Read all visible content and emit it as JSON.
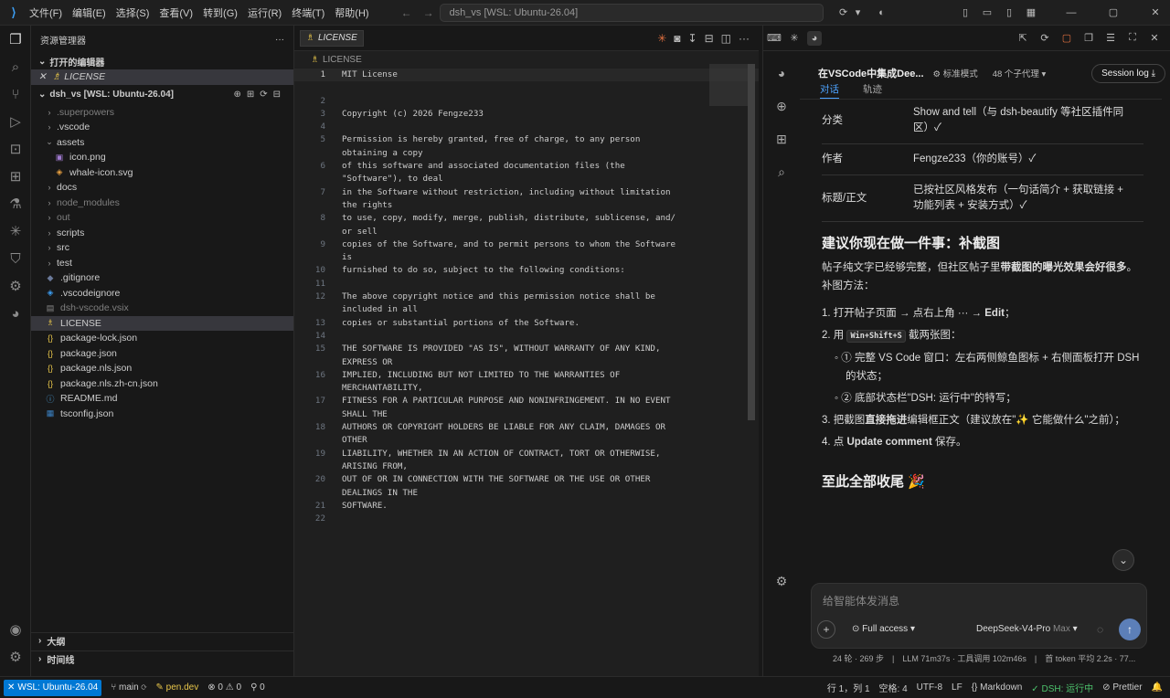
{
  "titlebar": {
    "menu": [
      "文件(F)",
      "编辑(E)",
      "选择(S)",
      "查看(V)",
      "转到(G)",
      "运行(R)",
      "终端(T)",
      "帮助(H)"
    ],
    "command_center": "dsh_vs [WSL: Ubuntu-26.04]"
  },
  "sidebar": {
    "title": "资源管理器",
    "open_editors": "打开的编辑器",
    "open_file": "LICENSE",
    "workspace": "dsh_vs [WSL: Ubuntu-26.04]",
    "tree": [
      {
        "name": ".superpowers",
        "type": "folder",
        "dim": true,
        "depth": 1
      },
      {
        "name": ".vscode",
        "type": "folder",
        "depth": 1
      },
      {
        "name": "assets",
        "type": "open",
        "depth": 1
      },
      {
        "name": "icon.png",
        "type": "img",
        "depth": 2
      },
      {
        "name": "whale-icon.svg",
        "type": "svg",
        "depth": 2
      },
      {
        "name": "docs",
        "type": "folder",
        "depth": 1
      },
      {
        "name": "node_modules",
        "type": "folder",
        "dim": true,
        "depth": 1
      },
      {
        "name": "out",
        "type": "folder",
        "dim": true,
        "depth": 1
      },
      {
        "name": "scripts",
        "type": "folder",
        "depth": 1
      },
      {
        "name": "src",
        "type": "folder",
        "depth": 1
      },
      {
        "name": "test",
        "type": "folder",
        "depth": 1
      },
      {
        "name": ".gitignore",
        "type": "git",
        "depth": 1
      },
      {
        "name": ".vscodeignore",
        "type": "vs",
        "depth": 1
      },
      {
        "name": "dsh-vscode.vsix",
        "type": "pkg",
        "dim": true,
        "depth": 1
      },
      {
        "name": "LICENSE",
        "type": "lic",
        "depth": 1,
        "sel": true
      },
      {
        "name": "package-lock.json",
        "type": "json",
        "depth": 1
      },
      {
        "name": "package.json",
        "type": "json",
        "depth": 1
      },
      {
        "name": "package.nls.json",
        "type": "json",
        "depth": 1
      },
      {
        "name": "package.nls.zh-cn.json",
        "type": "json",
        "depth": 1
      },
      {
        "name": "README.md",
        "type": "md",
        "depth": 1
      },
      {
        "name": "tsconfig.json",
        "type": "ts",
        "depth": 1
      }
    ],
    "outline": "大纲",
    "timeline": "时间线"
  },
  "editor": {
    "tab": "LICENSE",
    "breadcrumb": "LICENSE",
    "lines": [
      {
        "n": "1",
        "t": "MIT License"
      },
      {
        "n": "",
        "t": ""
      },
      {
        "n": "2",
        "t": ""
      },
      {
        "n": "3",
        "t": "Copyright (c) 2026 Fengze233"
      },
      {
        "n": "4",
        "t": ""
      },
      {
        "n": "5",
        "t": "Permission is hereby granted, free of charge, to any person"
      },
      {
        "n": "",
        "t": "obtaining a copy"
      },
      {
        "n": "6",
        "t": "of this software and associated documentation files (the"
      },
      {
        "n": "",
        "t": "\"Software\"), to deal"
      },
      {
        "n": "7",
        "t": "in the Software without restriction, including without limitation"
      },
      {
        "n": "",
        "t": "the rights"
      },
      {
        "n": "8",
        "t": "to use, copy, modify, merge, publish, distribute, sublicense, and/"
      },
      {
        "n": "",
        "t": "or sell"
      },
      {
        "n": "9",
        "t": "copies of the Software, and to permit persons to whom the Software"
      },
      {
        "n": "",
        "t": "is"
      },
      {
        "n": "10",
        "t": "furnished to do so, subject to the following conditions:"
      },
      {
        "n": "11",
        "t": ""
      },
      {
        "n": "12",
        "t": "The above copyright notice and this permission notice shall be"
      },
      {
        "n": "",
        "t": "included in all"
      },
      {
        "n": "13",
        "t": "copies or substantial portions of the Software."
      },
      {
        "n": "14",
        "t": ""
      },
      {
        "n": "15",
        "t": "THE SOFTWARE IS PROVIDED \"AS IS\", WITHOUT WARRANTY OF ANY KIND,"
      },
      {
        "n": "",
        "t": "EXPRESS OR"
      },
      {
        "n": "16",
        "t": "IMPLIED, INCLUDING BUT NOT LIMITED TO THE WARRANTIES OF"
      },
      {
        "n": "",
        "t": "MERCHANTABILITY,"
      },
      {
        "n": "17",
        "t": "FITNESS FOR A PARTICULAR PURPOSE AND NONINFRINGEMENT. IN NO EVENT"
      },
      {
        "n": "",
        "t": "SHALL THE"
      },
      {
        "n": "18",
        "t": "AUTHORS OR COPYRIGHT HOLDERS BE LIABLE FOR ANY CLAIM, DAMAGES OR"
      },
      {
        "n": "",
        "t": "OTHER"
      },
      {
        "n": "19",
        "t": "LIABILITY, WHETHER IN AN ACTION OF CONTRACT, TORT OR OTHERWISE,"
      },
      {
        "n": "",
        "t": "ARISING FROM,"
      },
      {
        "n": "20",
        "t": "OUT OF OR IN CONNECTION WITH THE SOFTWARE OR THE USE OR OTHER"
      },
      {
        "n": "",
        "t": "DEALINGS IN THE"
      },
      {
        "n": "21",
        "t": "SOFTWARE."
      },
      {
        "n": "22",
        "t": ""
      }
    ]
  },
  "chat": {
    "title": "在VSCode中集成Dee...",
    "mode": "标准模式",
    "agents": "48 个子代理",
    "session_log": "Session log",
    "tab_chat": "对话",
    "tab_track": "轨迹",
    "table": [
      [
        "分类",
        "Show and tell（与 dsh-beautify 等社区插件同区）✓"
      ],
      [
        "作者",
        "Fengze233（你的账号）✓"
      ],
      [
        "标题/正文",
        "已按社区风格发布（一句话简介 + 获取链接 + 功能列表 + 安装方式）✓"
      ]
    ],
    "h1": "建议你现在做一件事：补截图",
    "p1a": "帖子纯文字已经够完整，但社区帖子里",
    "p1b": "带截图的曝光效果会好很多",
    "p1c": "。补图方法：",
    "s1a": "1. 打开帖子页面 → 点右上角 ··· → ",
    "s1b": "Edit",
    "s1c": "；",
    "s2a": "2. 用 ",
    "s2k": "Win+Shift+S",
    "s2b": " 截两张图：",
    "b1": "① 完整 VS Code 窗口：左右两侧鲸鱼图标 + 右侧面板打开 DSH 的状态；",
    "b2": "② 底部状态栏\"DSH: 运行中\"的特写；",
    "s3a": "3. 把截图",
    "s3b": "直接拖进",
    "s3c": "编辑框正文（建议放在\"✨ 它能做什么\"之前）；",
    "s4a": "4. 点 ",
    "s4b": "Update comment",
    "s4c": " 保存。",
    "h2": "至此全部收尾 🎉",
    "placeholder": "给智能体发消息",
    "access": "Full access",
    "model": "DeepSeek-V4-Pro",
    "model_tier": "Max",
    "footer": "24 轮 · 269 步　|　LLM 71m37s · 工具调用 102m46s　|　首 token 平均 2.2s · 77..."
  },
  "status": {
    "remote": "WSL: Ubuntu-26.04",
    "branch": "main",
    "pen": "pen.dev",
    "errors": "0",
    "warnings": "0",
    "ports": "0",
    "position": "行 1，列 1",
    "spaces": "空格: 4",
    "encoding": "UTF-8",
    "eol": "LF",
    "lang": "Markdown",
    "dsh": "DSH: 运行中",
    "prettier": "Prettier"
  }
}
